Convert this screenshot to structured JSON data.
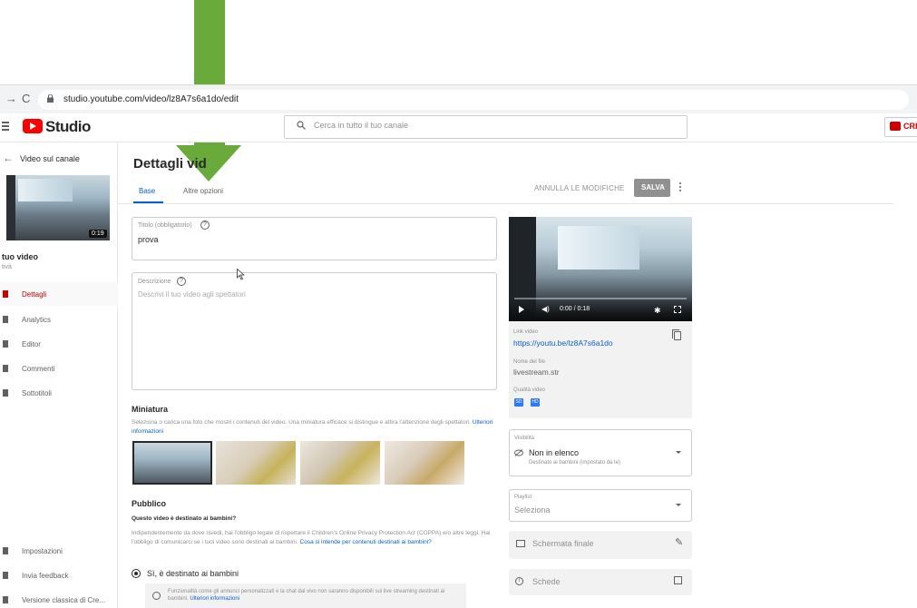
{
  "browser": {
    "url": "studio.youtube.com/video/lz8A7s6a1do/edit",
    "back_glyph": "←",
    "forward_glyph": "→",
    "reload_glyph": "C"
  },
  "header": {
    "logo_text": "Studio",
    "search_placeholder": "Cerca in tutto il tuo canale",
    "create_label": "CRE"
  },
  "sidebar": {
    "back_label": "Video sul canale",
    "thumb_duration": "0:19",
    "video_title": "tuo video",
    "video_sub": "tivà",
    "items": [
      {
        "label": "Dettagli"
      },
      {
        "label": "Analytics"
      },
      {
        "label": "Editor"
      },
      {
        "label": "Commenti"
      },
      {
        "label": "Sottotitoli"
      }
    ],
    "bottom_items": [
      {
        "label": "Impostazioni"
      },
      {
        "label": "Invia feedback"
      },
      {
        "label": "Versione classica di Cre..."
      }
    ]
  },
  "main": {
    "title": "Dettagli vid",
    "tabs": [
      {
        "label": "Base"
      },
      {
        "label": "Altre opzioni"
      }
    ],
    "undo_label": "ANNULLA LE MODIFICHE",
    "save_label": "SALVA",
    "title_field": {
      "label": "Titolo (obbligatorio)",
      "value": "prova"
    },
    "description_field": {
      "label": "Descrizione",
      "placeholder": "Descrivi il tuo video agli spettatori"
    },
    "thumbnails": {
      "heading": "Miniatura",
      "desc": "Seleziona o carica una foto che mostri i contenuti del video. Una miniatura efficace si distingue e attira l'attenzione degli spettatori.",
      "link": "Ulteriori informazioni"
    },
    "audience": {
      "heading": "Pubblico",
      "question": "Questo video è destinato ai bambini?",
      "text": "Indipendentemente da dove risiedi, hai l'obbligo legale di rispettare il Children's Online Privacy Protection Act (COPPA) e/o altre leggi. Hai l'obbligo di comunicarci se i tuoi video sono destinati ai bambini.",
      "link": "Cosa si intende per contenuti destinati ai bambini?",
      "radio_label": "Sì, è destinato ai bambini",
      "note": "Funzionalità come gli annunci personalizzati e la chat dal vivo non saranno disponibili sui live streaming destinati ai bambini.",
      "note_link": "Ulteriori informazioni"
    }
  },
  "right": {
    "player_time": "0:00 / 0:18",
    "volume_glyph": "◀)",
    "settings_glyph": "✱",
    "link_label": "Link video",
    "link_value": "https://youtu.be/lz8A7s6a1do",
    "filename_label": "Nome del file",
    "filename_value": "livestream.str",
    "quality_label": "Qualità video",
    "quality_badges": [
      "SD",
      "HD"
    ],
    "visibility_label": "Visibilità",
    "visibility_value": "Non in elenco",
    "visibility_sub": "Destinato ai bambini (impostato da te)",
    "playlist_label": "Playlist",
    "playlist_value": "Seleziona",
    "endscreen_label": "Schermata finale",
    "endscreen_edit_glyph": "✎",
    "cards_label": "Schede",
    "cards_glyph": "i"
  },
  "colors": {
    "accent_blue": "#065fd4",
    "brand_red": "#ff0000",
    "arrow_green": "#6aaa3a"
  },
  "icons": [
    "menu-icon",
    "search-icon",
    "create-icon",
    "help-icon",
    "cursor-icon",
    "play-icon",
    "volume-icon",
    "settings-icon",
    "fullscreen-icon",
    "copy-icon",
    "visibility-icon",
    "endscreen-icon",
    "edit-icon",
    "info-icon",
    "open-icon",
    "more-vert-icon",
    "green-arrow-icon"
  ]
}
